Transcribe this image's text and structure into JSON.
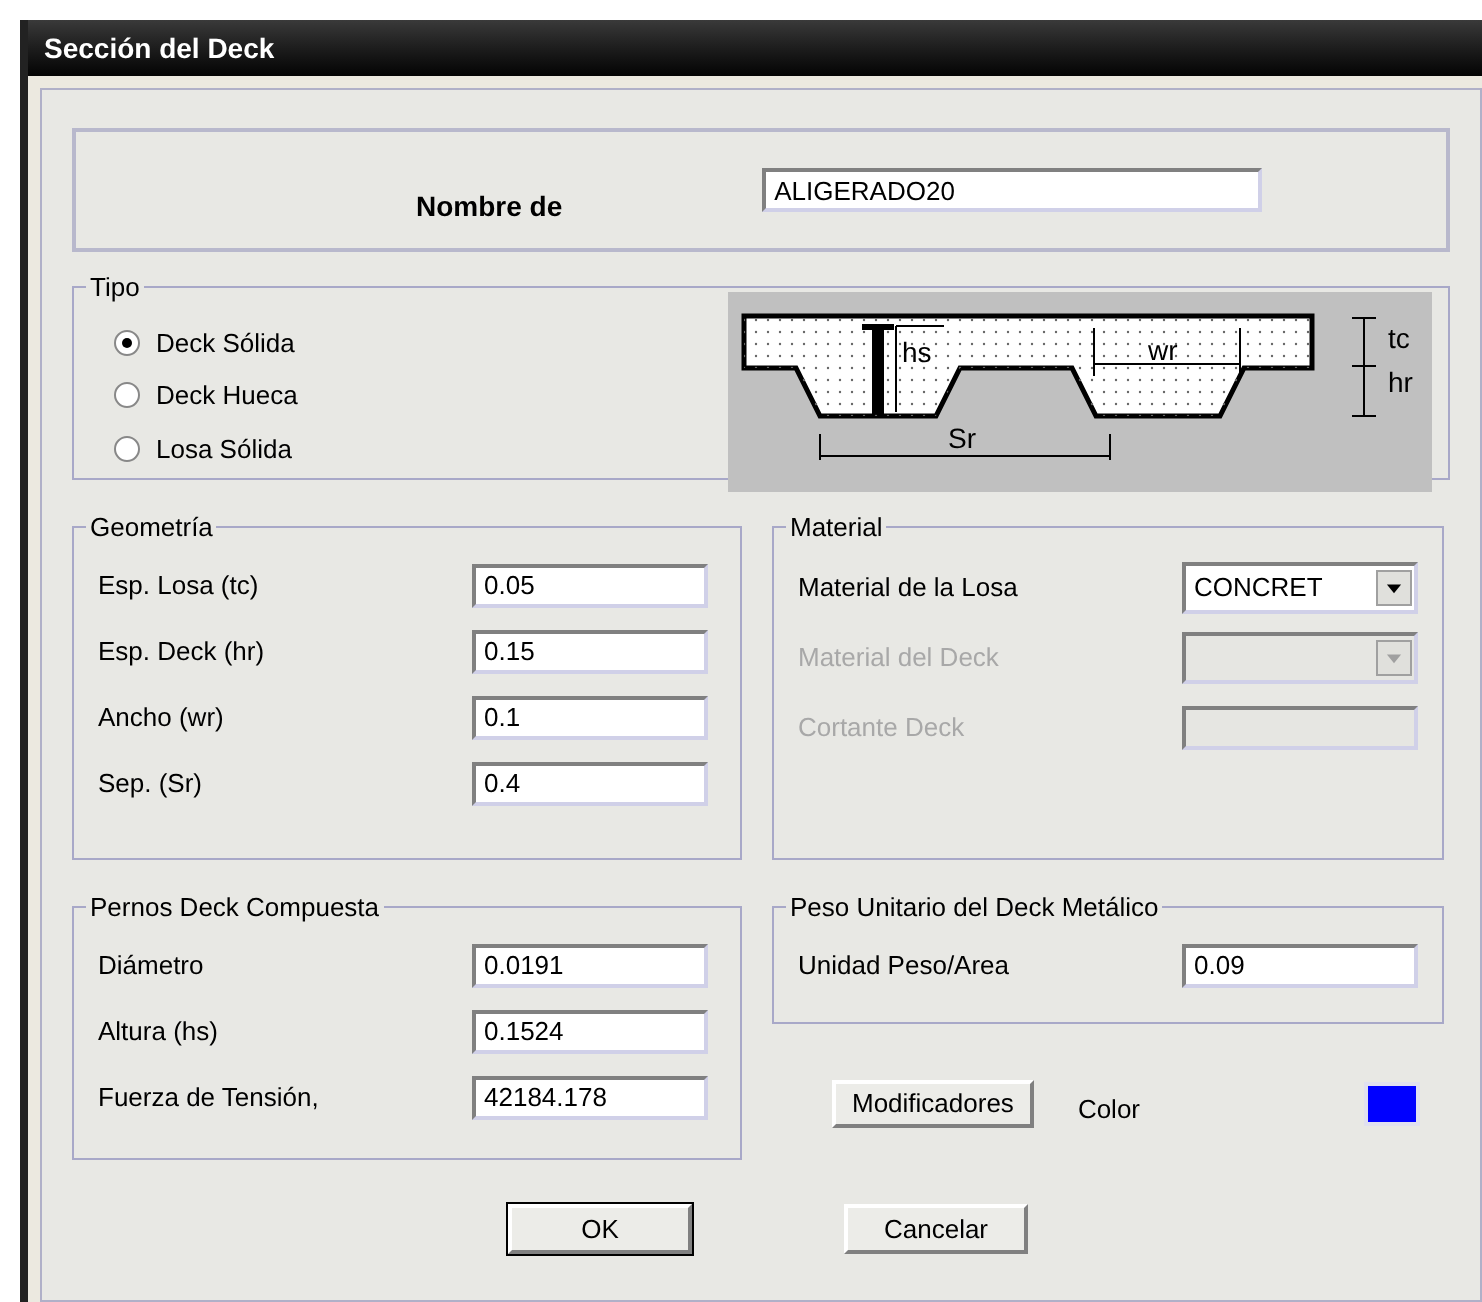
{
  "window": {
    "title": "Sección del Deck"
  },
  "name_field": {
    "label": "Nombre de",
    "value": "ALIGERADO20"
  },
  "tipo": {
    "title": "Tipo",
    "options": [
      {
        "label": "Deck Sólida",
        "selected": true
      },
      {
        "label": "Deck Hueca",
        "selected": false
      },
      {
        "label": "Losa Sólida",
        "selected": false
      }
    ],
    "diagram_labels": {
      "hs": "hs",
      "wr": "wr",
      "sr": "Sr",
      "tc": "tc",
      "hr": "hr"
    }
  },
  "geometria": {
    "title": "Geometría",
    "fields": [
      {
        "label": "Esp. Losa (tc)",
        "value": "0.05"
      },
      {
        "label": "Esp. Deck (hr)",
        "value": "0.15"
      },
      {
        "label": "Ancho (wr)",
        "value": "0.1"
      },
      {
        "label": "Sep. (Sr)",
        "value": "0.4"
      }
    ]
  },
  "material": {
    "title": "Material",
    "fields": [
      {
        "kind": "dropdown",
        "label": "Material de la Losa",
        "value": "CONCRET",
        "disabled": false
      },
      {
        "kind": "dropdown",
        "label": "Material del Deck",
        "disabled": true
      },
      {
        "kind": "text",
        "label": "Cortante Deck",
        "disabled": true
      }
    ]
  },
  "pernos": {
    "title": "Pernos Deck Compuesta",
    "fields": [
      {
        "label": "Diámetro",
        "value": "0.0191"
      },
      {
        "label": "Altura (hs)",
        "value": "0.1524"
      },
      {
        "label": "Fuerza de Tensión,",
        "value": "42184.178"
      }
    ]
  },
  "peso": {
    "title": "Peso Unitario del Deck Metálico",
    "fields": [
      {
        "label": "Unidad Peso/Area",
        "value": "0.09"
      }
    ]
  },
  "modifiers_button": "Modificadores",
  "color": {
    "label": "Color",
    "color": "#0000ff"
  },
  "buttons": [
    "OK",
    "Cancelar"
  ]
}
